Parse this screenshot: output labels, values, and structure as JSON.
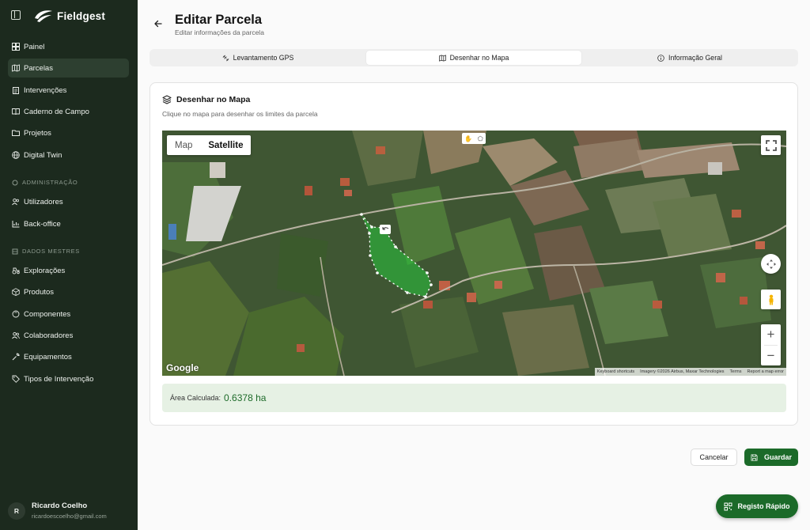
{
  "app": {
    "name": "Fieldgest"
  },
  "sidebar": {
    "items": [
      {
        "label": "Painel",
        "icon": "dashboard-icon"
      },
      {
        "label": "Parcelas",
        "icon": "map-icon",
        "active": true
      },
      {
        "label": "Intervenções",
        "icon": "clipboard-icon"
      },
      {
        "label": "Caderno de Campo",
        "icon": "book-icon"
      },
      {
        "label": "Projetos",
        "icon": "folder-icon"
      },
      {
        "label": "Digital Twin",
        "icon": "globe-icon"
      }
    ],
    "admin_label": "ADMINISTRAÇÃO",
    "admin_items": [
      {
        "label": "Utilizadores",
        "icon": "users-icon"
      },
      {
        "label": "Back-office",
        "icon": "chart-icon"
      }
    ],
    "master_label": "DADOS MESTRES",
    "master_items": [
      {
        "label": "Explorações",
        "icon": "tractor-icon"
      },
      {
        "label": "Produtos",
        "icon": "package-icon"
      },
      {
        "label": "Componentes",
        "icon": "component-icon"
      },
      {
        "label": "Colaboradores",
        "icon": "team-icon"
      },
      {
        "label": "Equipamentos",
        "icon": "wrench-icon"
      },
      {
        "label": "Tipos de Intervenção",
        "icon": "tag-icon"
      }
    ],
    "user": {
      "initial": "R",
      "name": "Ricardo Coelho",
      "email": "ricardoescoelho@gmail.com"
    }
  },
  "header": {
    "title": "Editar Parcela",
    "subtitle": "Editar informações da parcela"
  },
  "tabs": [
    {
      "label": "Levantamento GPS",
      "icon": "satellite-icon"
    },
    {
      "label": "Desenhar no Mapa",
      "icon": "map-icon",
      "active": true
    },
    {
      "label": "Informação Geral",
      "icon": "info-icon"
    }
  ],
  "card": {
    "title": "Desenhar no Mapa",
    "description": "Clique no mapa para desenhar os limites da parcela"
  },
  "map": {
    "type_map": "Map",
    "type_satellite": "Satellite",
    "google": "Google",
    "attribution": [
      "Keyboard shortcuts",
      "Imagery ©2026 Airbus, Maxar Technologies",
      "Terms",
      "Report a map error"
    ]
  },
  "area": {
    "label": "Área Calculada:",
    "value": "0.6378 ha"
  },
  "actions": {
    "cancel": "Cancelar",
    "save": "Guardar",
    "quick": "Registo Rápido"
  },
  "colors": {
    "sidebar": "#1c2a1e",
    "accent": "#1b6a29",
    "area_bg": "#e6f1e4"
  }
}
